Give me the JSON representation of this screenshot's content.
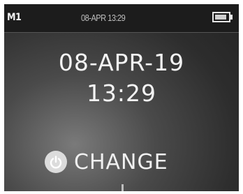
{
  "status_bar": {
    "memory_label": "M1",
    "datetime": "08-APR 13:29",
    "battery_level": 0.9
  },
  "main": {
    "date": "08-APR-19",
    "time": "13:29"
  },
  "change_button": {
    "label": "CHANGE",
    "icon": "power-icon"
  },
  "colors": {
    "screen_bg": "#2d2d2d",
    "text": "#f4f4f4",
    "status_bar_bg": "#1c1c1c"
  }
}
